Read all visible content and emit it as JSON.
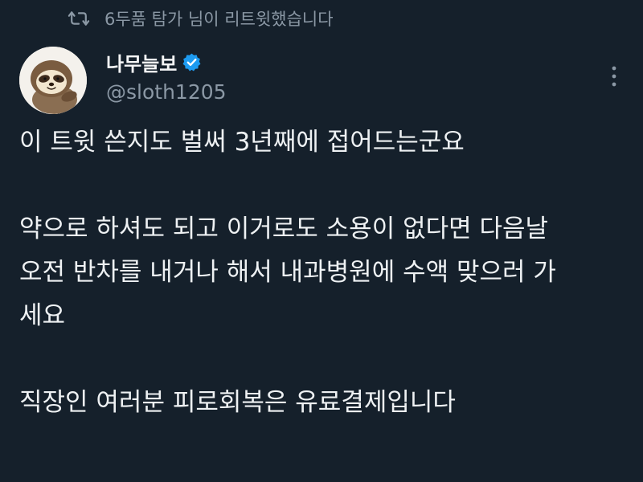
{
  "retweet": {
    "text": "6두품 탐가 님이 리트윗했습니다",
    "icon": "retweet-icon"
  },
  "author": {
    "display_name": "나무늘보",
    "handle": "@sloth1205",
    "verified": true,
    "verified_color": "#1d9bf0",
    "avatar_icon": "sloth-avatar"
  },
  "more_icon": "more-vertical-icon",
  "tweet": {
    "paragraphs": [
      "이 트윗 쓴지도 벌써 3년째에 접어드는군요",
      "약으로 하셔도 되고 이거로도 소용이 없다면 다음날\n오전 반차를 내거나 해서 내과병원에 수액 맞으러 가\n세요",
      "직장인 여러분 피로회복은 유료결제입니다"
    ]
  },
  "colors": {
    "background": "#15202b",
    "text": "#e7e9ea",
    "muted": "#8b98a5"
  }
}
